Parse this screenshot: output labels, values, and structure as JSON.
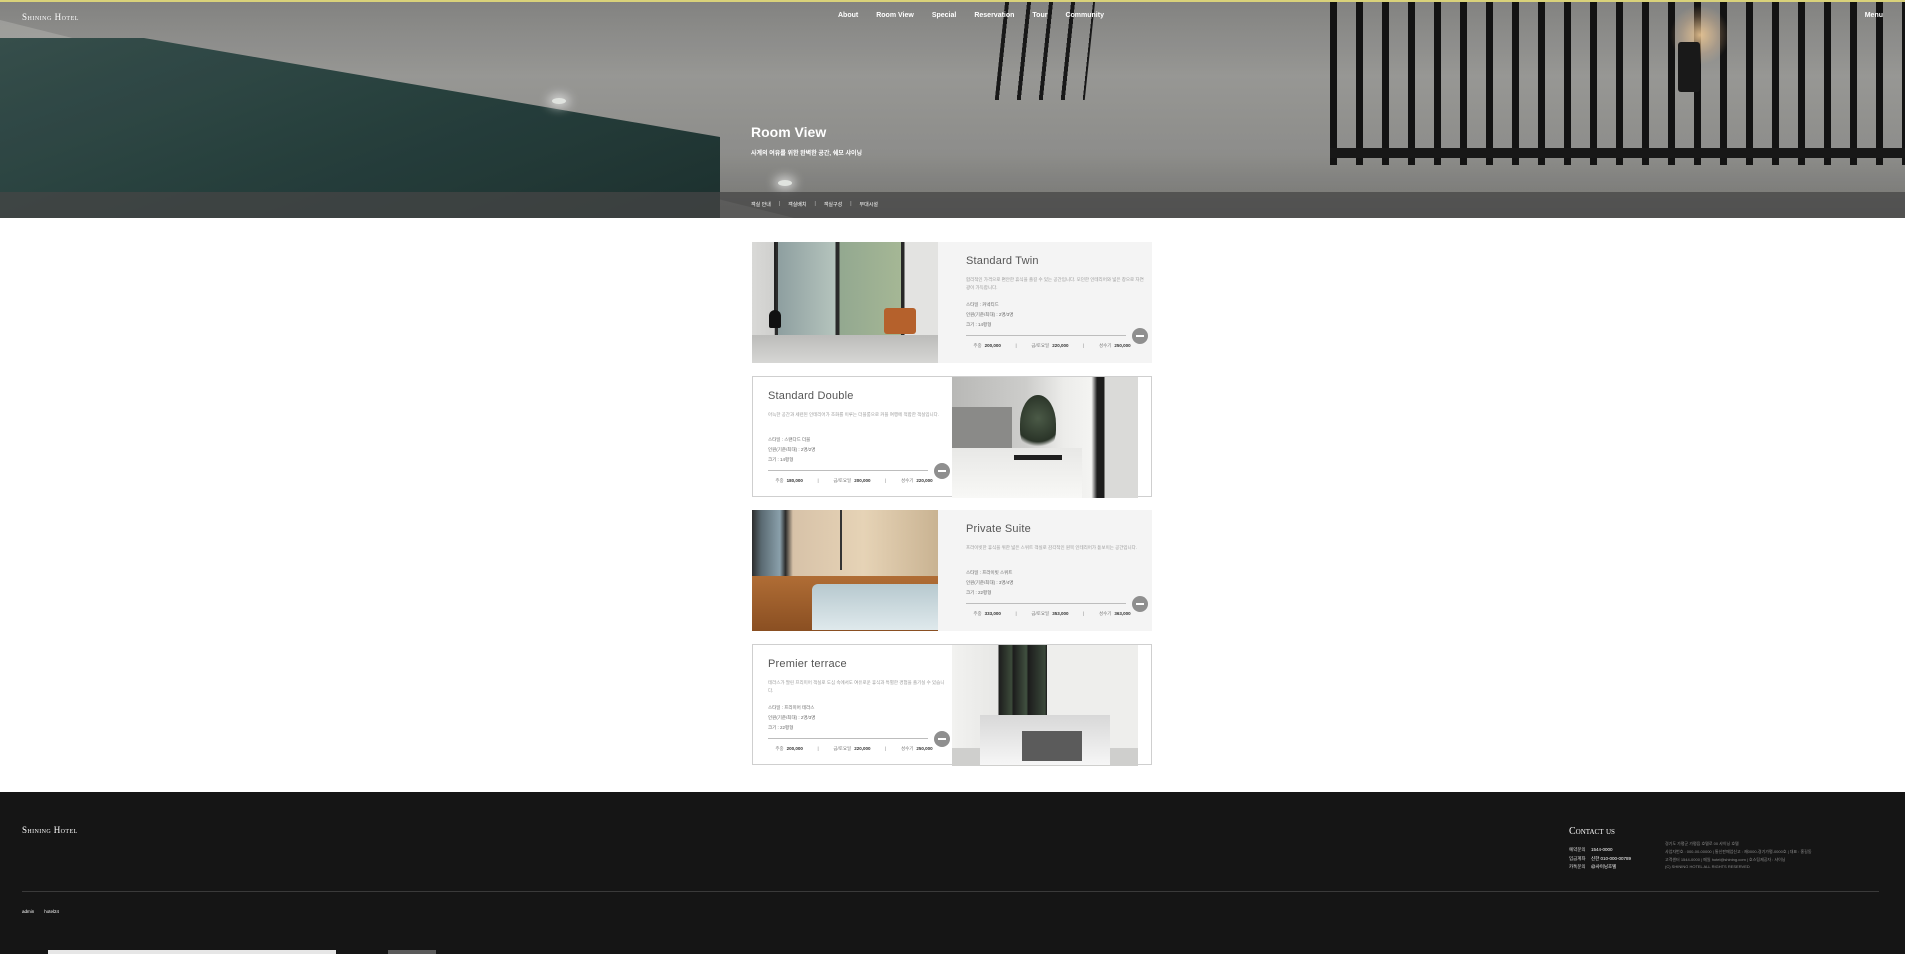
{
  "header": {
    "logo": "Shining Hotel",
    "nav": [
      "About",
      "Room View",
      "Special",
      "Reservation",
      "Tour",
      "Community"
    ],
    "menu": "Menu"
  },
  "hero": {
    "title": "Room View",
    "subtitle": "사계의 여유를 위한 완벽한 공간, 쉐모 샤이닝",
    "tabs": [
      "객실 안내",
      "객실배치",
      "객실구성",
      "부대시설"
    ]
  },
  "rooms": [
    {
      "name": "Standard Twin",
      "description": "합리적인 가격으로 편안한 휴식을 즐길 수 있는 공간입니다. 모던한 인테리어와 넓은 창으로 자연광이 가득합니다.",
      "type_label": "스타일",
      "type": "커넥티드",
      "bed_label": "인원(기준/최대)",
      "bed": "2명/3명",
      "size_label": "크기",
      "size": "14평형",
      "prices": [
        {
          "label": "주중",
          "value": "200,000"
        },
        {
          "label": "금/토요일",
          "value": "220,000"
        },
        {
          "label": "성수기",
          "value": "250,000"
        }
      ]
    },
    {
      "name": "Standard Double",
      "description": "아늑한 공간과 세련된 인테리어가 조화를 이루는 더블룸으로 커플 여행에 적합한 객실입니다.",
      "type_label": "스타일",
      "type": "스탠다드 더블",
      "bed_label": "인원(기준/최대)",
      "bed": "2명/2명",
      "size_label": "크기",
      "size": "14평형",
      "prices": [
        {
          "label": "주중",
          "value": "180,000"
        },
        {
          "label": "금/토요일",
          "value": "200,000"
        },
        {
          "label": "성수기",
          "value": "220,000"
        }
      ]
    },
    {
      "name": "Private Suite",
      "description": "프라이빗한 휴식을 위한 넓은 스위트 객실로 감각적인 원목 인테리어가 돋보이는 공간입니다.",
      "type_label": "스타일",
      "type": "프라이빗 스위트",
      "bed_label": "인원(기준/최대)",
      "bed": "3명/4명",
      "size_label": "크기",
      "size": "22평형",
      "prices": [
        {
          "label": "주중",
          "value": "333,000"
        },
        {
          "label": "금/토요일",
          "value": "353,000"
        },
        {
          "label": "성수기",
          "value": "363,000"
        }
      ]
    },
    {
      "name": "Premier terrace",
      "description": "테라스가 딸린 프리미어 객실로 도심 속에서도 여유로운 휴식과 특별한 경험을 즐기실 수 있습니다.",
      "type_label": "스타일",
      "type": "프리미어 테라스",
      "bed_label": "인원(기준/최대)",
      "bed": "2명/3명",
      "size_label": "크기",
      "size": "22평형",
      "prices": [
        {
          "label": "주중",
          "value": "200,000"
        },
        {
          "label": "금/토요일",
          "value": "220,000"
        },
        {
          "label": "성수기",
          "value": "250,000"
        }
      ]
    }
  ],
  "footer": {
    "logo": "Shining Hotel",
    "contact_title": "Contact us",
    "contacts": [
      {
        "label": "예약문의",
        "value": "1544-0000"
      },
      {
        "label": "입금계좌",
        "value": "신한 010-000-00789"
      },
      {
        "label": "카톡문의",
        "value": "@샤이닝호텔"
      }
    ],
    "address_lines": [
      "경기도 가평군 가평읍 호텔로 00 샤이닝 호텔",
      "사업자번호 : 000-00-00000 | 통신판매업신고 : 제0000-경기가평-0000호 | 대표 : 홍길동",
      "고객센터 1544-0000 | 메일 hotel@shining.com | 호스팅제공자 : 샤이닝",
      "(C) SHINING HOTEL ALL RIGHTS RESERVED"
    ],
    "links": [
      "admin",
      "hotel24"
    ]
  },
  "colors": {
    "accent_line": "#d9d27a",
    "footer_bg": "#151515",
    "card_gray": "#f4f4f4"
  }
}
